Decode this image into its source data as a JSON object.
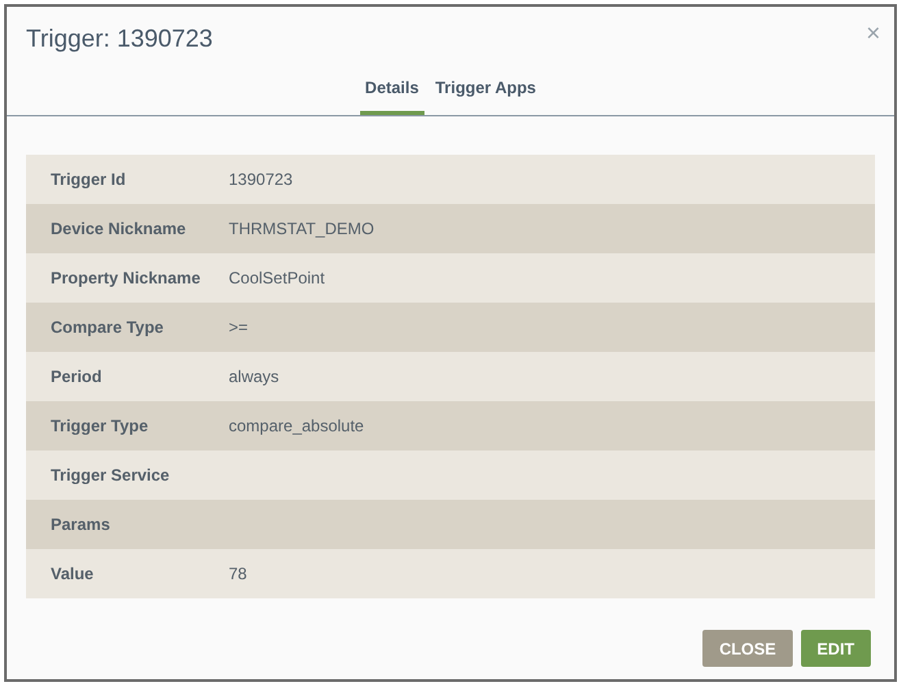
{
  "dialog": {
    "title": "Trigger: 1390723",
    "close_glyph": "×"
  },
  "tabs": [
    {
      "label": "Details",
      "selected": true
    },
    {
      "label": "Trigger Apps",
      "selected": false
    }
  ],
  "details": [
    {
      "label": "Trigger Id",
      "value": "1390723"
    },
    {
      "label": "Device Nickname",
      "value": "THRMSTAT_DEMO"
    },
    {
      "label": "Property Nickname",
      "value": "CoolSetPoint"
    },
    {
      "label": "Compare Type",
      "value": ">="
    },
    {
      "label": "Period",
      "value": "always"
    },
    {
      "label": "Trigger Type",
      "value": "compare_absolute"
    },
    {
      "label": "Trigger Service"
    },
    {
      "label": "Params"
    },
    {
      "label": "Value",
      "value": "78"
    }
  ],
  "buttons": [
    {
      "label": "CLOSE",
      "kind": "secondary"
    },
    {
      "label": "EDIT",
      "kind": "primary"
    }
  ]
}
